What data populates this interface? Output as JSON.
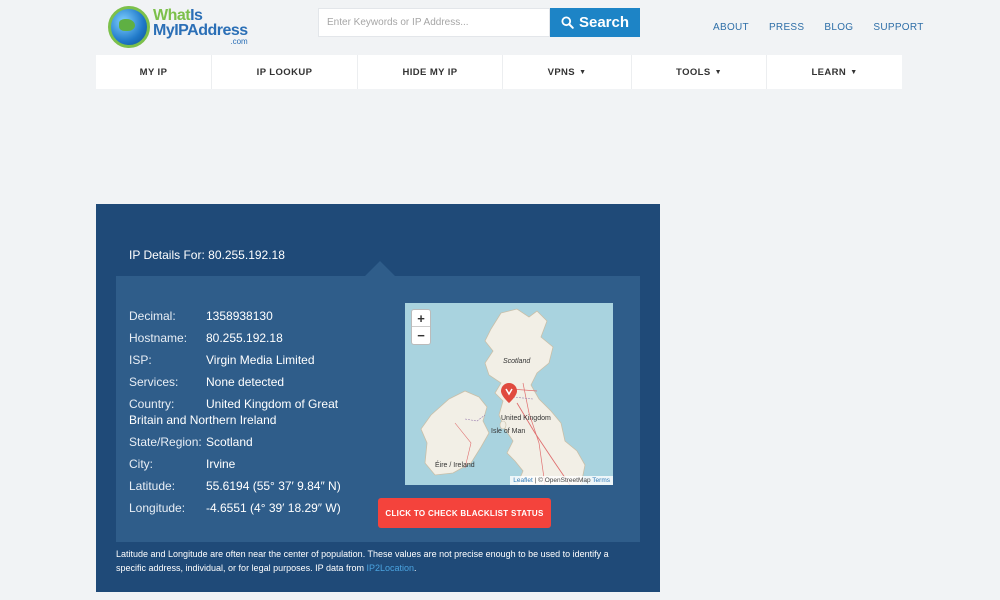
{
  "logo": {
    "line1a": "What",
    "line1b": "Is",
    "line2": "MyIPAddress",
    "line3": ".com"
  },
  "search": {
    "placeholder": "Enter Keywords or IP Address...",
    "button_label": "Search"
  },
  "top_links": [
    "ABOUT",
    "PRESS",
    "BLOG",
    "SUPPORT"
  ],
  "nav": [
    {
      "label": "MY IP",
      "dropdown": false
    },
    {
      "label": "IP LOOKUP",
      "dropdown": false
    },
    {
      "label": "HIDE MY IP",
      "dropdown": false
    },
    {
      "label": "VPNS",
      "dropdown": true
    },
    {
      "label": "TOOLS",
      "dropdown": true
    },
    {
      "label": "LEARN",
      "dropdown": true
    }
  ],
  "details": {
    "title_prefix": "IP Details For:",
    "ip": "80.255.192.18",
    "rows": [
      {
        "label": "Decimal:",
        "value": "1358938130"
      },
      {
        "label": "Hostname:",
        "value": "80.255.192.18"
      },
      {
        "label": "ISP:",
        "value": "Virgin Media Limited"
      },
      {
        "label": "Services:",
        "value": "None detected"
      },
      {
        "label": "Country:",
        "value": "United Kingdom of Great Britain and Northern Ireland"
      },
      {
        "label": "State/Region:",
        "value": "Scotland"
      },
      {
        "label": "City:",
        "value": "Irvine"
      },
      {
        "label": "Latitude:",
        "value": "55.6194 (55° 37′ 9.84″ N)"
      },
      {
        "label": "Longitude:",
        "value": "-4.6551 (4° 39′ 18.29″ W)"
      }
    ]
  },
  "map": {
    "zoom_in": "+",
    "zoom_out": "−",
    "labels": [
      "Scotland",
      "United Kingdom",
      "Isle of Man",
      "Éire / Ireland"
    ],
    "attrib_leaflet": "Leaflet",
    "attrib_mid": " | © OpenStreetMap ",
    "attrib_terms": "Terms"
  },
  "blacklist_button": "CLICK TO CHECK BLACKLIST STATUS",
  "note": {
    "text": "Latitude and Longitude are often near the center of population. These values are not precise enough to be used to identify a specific address, individual, or for legal purposes. IP data from ",
    "link": "IP2Location",
    "end": "."
  },
  "colors": {
    "panel": "#1f4a78",
    "inner": "#2f5d8a",
    "search_button": "#1d84c6",
    "blacklist_button": "#f4433c",
    "link": "#2f6fa8"
  }
}
